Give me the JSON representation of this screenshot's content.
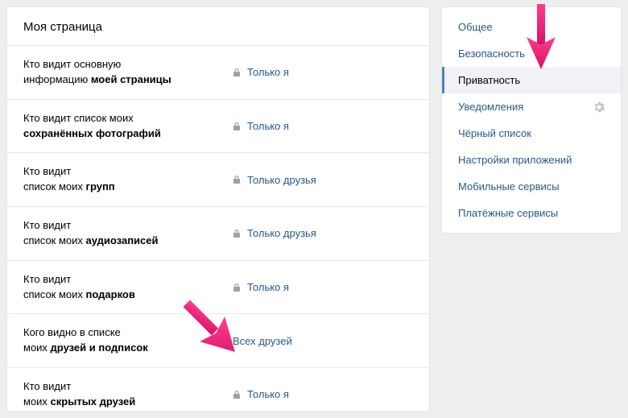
{
  "page_title": "Моя страница",
  "rows": [
    {
      "label_pre": "Кто видит основную\nинформацию ",
      "label_bold": "моей страницы",
      "has_lock": true,
      "value": "Только я"
    },
    {
      "label_pre": "Кто видит список моих\n",
      "label_bold": "сохранённых фотографий",
      "has_lock": true,
      "value": "Только я"
    },
    {
      "label_pre": "Кто видит\nсписок моих ",
      "label_bold": "групп",
      "has_lock": true,
      "value": "Только друзья"
    },
    {
      "label_pre": "Кто видит\nсписок моих ",
      "label_bold": "аудиозаписей",
      "has_lock": true,
      "value": "Только друзья"
    },
    {
      "label_pre": "Кто видит\nсписок моих ",
      "label_bold": "подарков",
      "has_lock": true,
      "value": "Только я"
    },
    {
      "label_pre": "Кого видно в списке\nмоих ",
      "label_bold": "друзей и подписок",
      "has_lock": false,
      "value": "Всех друзей"
    },
    {
      "label_pre": "Кто видит\nмоих ",
      "label_bold": "скрытых друзей",
      "has_lock": true,
      "value": "Только я"
    }
  ],
  "nav": [
    {
      "label": "Общее",
      "active": false,
      "gear": false
    },
    {
      "label": "Безопасность",
      "active": false,
      "gear": false
    },
    {
      "label": "Приватность",
      "active": true,
      "gear": false
    },
    {
      "label": "Уведомления",
      "active": false,
      "gear": true
    },
    {
      "label": "Чёрный список",
      "active": false,
      "gear": false
    },
    {
      "label": "Настройки приложений",
      "active": false,
      "gear": false
    },
    {
      "label": "Мобильные сервисы",
      "active": false,
      "gear": false
    },
    {
      "label": "Платёжные сервисы",
      "active": false,
      "gear": false
    }
  ],
  "arrow_color": "#e91e7a"
}
